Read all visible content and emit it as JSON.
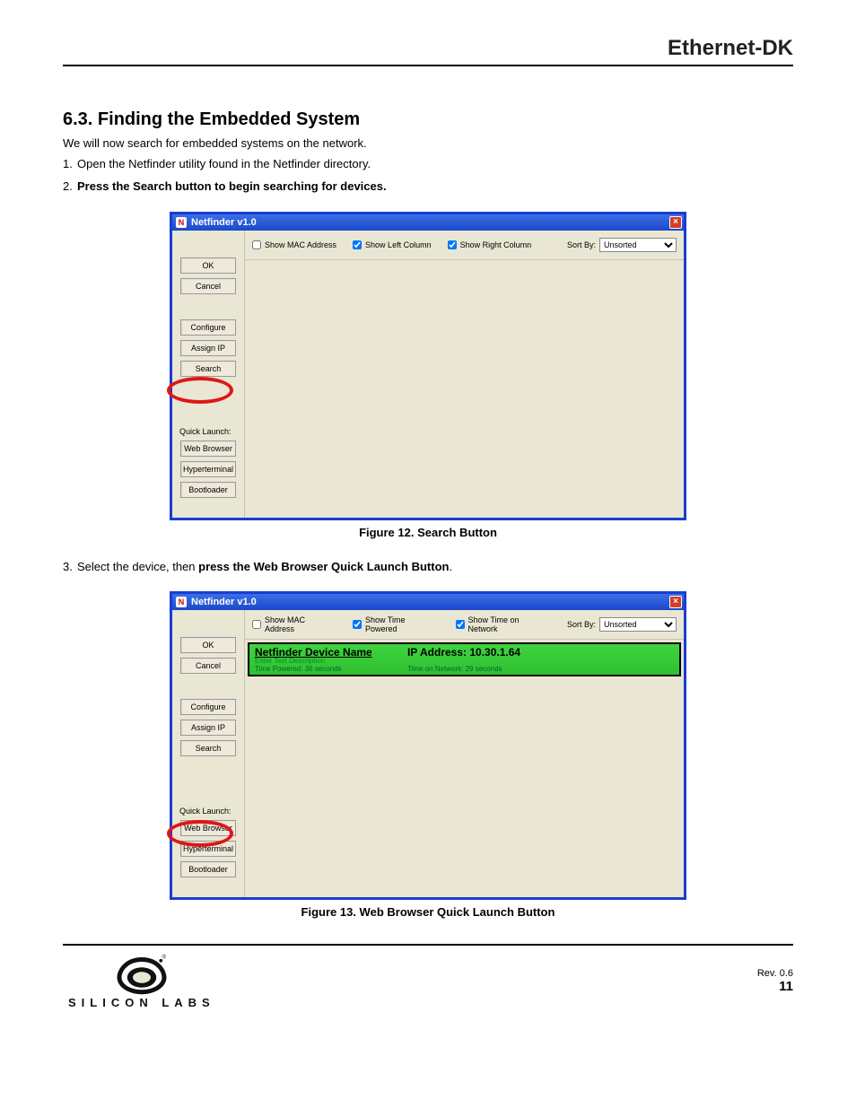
{
  "doc": {
    "header": "Ethernet-DK",
    "section_heading": "6.3.  Finding the Embedded System",
    "intro": "We will now search for embedded systems on the network.",
    "steps": [
      "Open the Netfinder utility found in the Netfinder directory.",
      "Press the Search button to begin searching for devices."
    ],
    "figure12_caption": "Figure 12. Search Button",
    "step3": "Select the device, then press the Web Browser Quick Launch Button.",
    "figure13_caption": "Figure 13. Web Browser Quick Launch Button"
  },
  "win": {
    "title": "Netfinder v1.0",
    "close": "×",
    "buttons": {
      "ok": "OK",
      "cancel": "Cancel",
      "configure": "Configure",
      "assign_ip": "Assign IP",
      "search": "Search",
      "web_browser": "Web Browser",
      "hyperterminal": "Hyperterminal",
      "bootloader": "Bootloader"
    },
    "quick_launch": "Quick Launch:",
    "toolbar1": {
      "show_mac": "Show MAC Address",
      "show_left": "Show Left Column",
      "show_right": "Show Right Column",
      "sort_by": "Sort By:",
      "sort_value": "Unsorted"
    },
    "toolbar2": {
      "show_mac": "Show MAC Address",
      "show_time_powered": "Show Time Powered",
      "show_time_network": "Show Time on Network",
      "sort_by": "Sort By:",
      "sort_value": "Unsorted"
    },
    "device": {
      "name": "Netfinder Device Name",
      "desc": "Enter Text Description",
      "ip": "IP Address: 10.30.1.64",
      "time_powered": "Time Powered:  36 seconds",
      "time_network": "Time on Network:  29 seconds"
    }
  },
  "footer": {
    "rev": "Rev. 0.6",
    "page": "11",
    "brand": "SILICON LABS"
  }
}
